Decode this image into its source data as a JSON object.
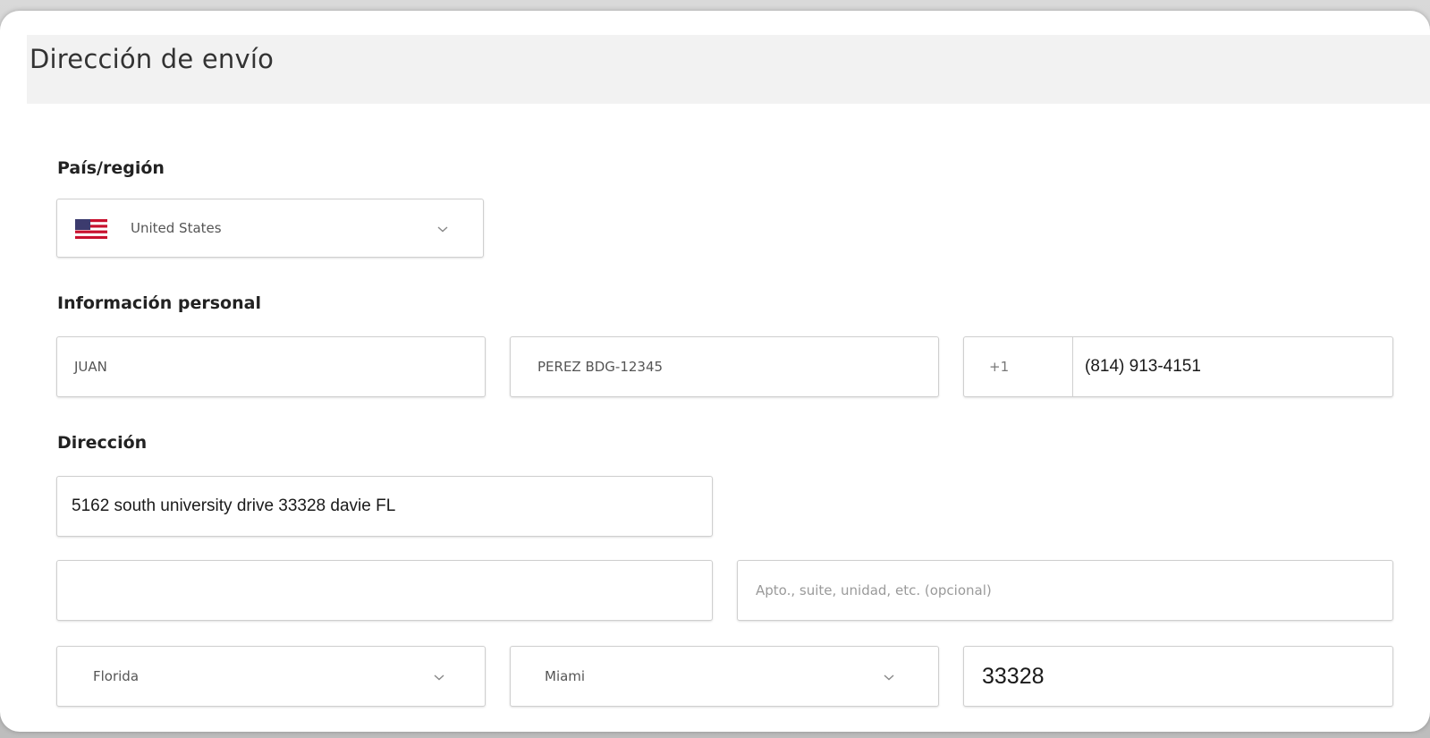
{
  "header": {
    "title": "Dirección de envío"
  },
  "sections": {
    "country_label": "País/región",
    "personal_label": "Información personal",
    "address_label": "Dirección"
  },
  "country": {
    "value": "United States",
    "flag_icon": "us-flag-icon"
  },
  "personal": {
    "first_name": "JUAN",
    "last_name": "PEREZ BDG-12345",
    "phone_code": "+1",
    "phone_number": "(814) 913-4151"
  },
  "address": {
    "line1": "5162 south university drive 33328 davie FL",
    "line2_value": "",
    "apt_placeholder": "Apto., suite, unidad, etc. (opcional)",
    "state": "Florida",
    "city": "Miami",
    "zip": "33328"
  },
  "colors": {
    "header_bg": "#f2f2f2",
    "border": "#cfcfcf",
    "flag_red": "#c8102e",
    "flag_blue": "#3c3b6e"
  }
}
